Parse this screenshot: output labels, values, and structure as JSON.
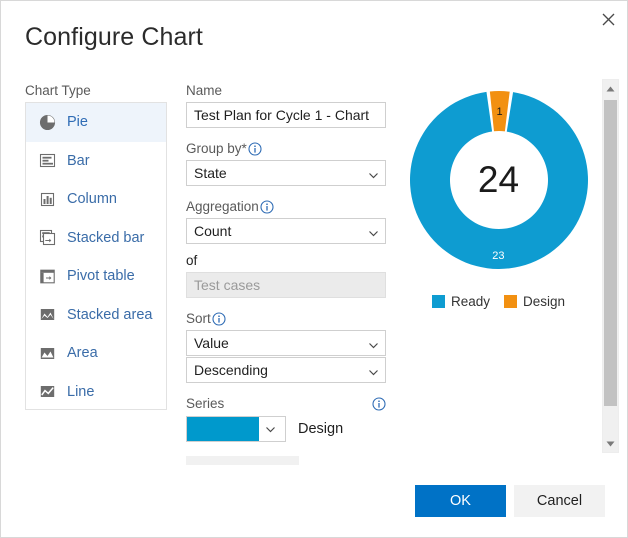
{
  "dialog": {
    "title": "Configure Chart",
    "close_icon": "close-icon"
  },
  "chart_type": {
    "label": "Chart Type",
    "selected": "Pie",
    "items": [
      {
        "label": "Pie",
        "icon": "pie-chart-icon"
      },
      {
        "label": "Bar",
        "icon": "bar-chart-icon"
      },
      {
        "label": "Column",
        "icon": "column-chart-icon"
      },
      {
        "label": "Stacked bar",
        "icon": "stacked-bar-chart-icon"
      },
      {
        "label": "Pivot table",
        "icon": "pivot-table-icon"
      },
      {
        "label": "Stacked area",
        "icon": "stacked-area-chart-icon"
      },
      {
        "label": "Area",
        "icon": "area-chart-icon"
      },
      {
        "label": "Line",
        "icon": "line-chart-icon"
      }
    ]
  },
  "form": {
    "name": {
      "label": "Name",
      "value": "Test Plan for Cycle 1 - Chart"
    },
    "group_by": {
      "label": "Group by*",
      "info_icon": "info-icon",
      "value": "State"
    },
    "aggregation": {
      "label": "Aggregation",
      "info_icon": "info-icon",
      "value": "Count",
      "of_label": "of",
      "of_value": "Test cases"
    },
    "sort": {
      "label": "Sort",
      "info_icon": "info-icon",
      "field_value": "Value",
      "order_value": "Descending"
    },
    "series": {
      "label": "Series",
      "info_icon": "info-icon",
      "color": "#0099cc",
      "name": "Design"
    }
  },
  "chart_data": {
    "type": "pie",
    "title": "",
    "variant": "donut",
    "center_label": "24",
    "total": 24,
    "categories": [
      "Ready",
      "Design"
    ],
    "values": [
      23,
      1
    ],
    "colors": [
      "#0e9cd1",
      "#f29011"
    ],
    "data_labels": [
      "23",
      "1"
    ],
    "legend_position": "bottom",
    "legend": [
      {
        "name": "Ready",
        "color": "#0e9cd1",
        "value": 23
      },
      {
        "name": "Design",
        "color": "#f29011",
        "value": 1
      }
    ]
  },
  "scrollbar": {
    "up_icon": "scroll-up-arrow-icon",
    "down_icon": "scroll-down-arrow-icon"
  },
  "footer": {
    "ok_label": "OK",
    "cancel_label": "Cancel",
    "ok_color": "#0072c6"
  }
}
